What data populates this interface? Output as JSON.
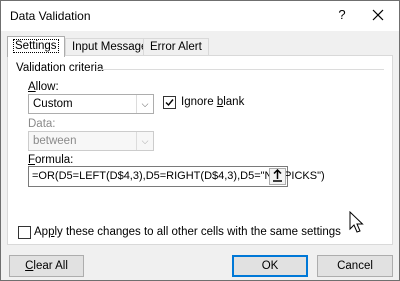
{
  "window": {
    "title": "Data Validation",
    "help_label": "?",
    "close_label": "✕"
  },
  "tabs": [
    {
      "label": "Settings",
      "active": true
    },
    {
      "label": "Input Message",
      "active": false
    },
    {
      "label": "Error Alert",
      "active": false
    }
  ],
  "criteria": {
    "group_label": "Validation criteria",
    "allow": {
      "label_mnemonic": "A",
      "label_rest": "llow:",
      "value": "Custom"
    },
    "ignore_blank": {
      "label_before": "Ignore ",
      "label_mnemonic": "b",
      "label_after": "lank",
      "checked": true
    },
    "data": {
      "label": "Data:",
      "value": "between",
      "disabled": true
    },
    "formula": {
      "label_mnemonic": "F",
      "label_rest": "ormula:",
      "value": "=OR(D5=LEFT(D$4,3),D5=RIGHT(D$4,3),D5=\"NO PICKS\")"
    }
  },
  "apply_all": {
    "label_before": "Ap",
    "label_mnemonic": "p",
    "label_after": "ly these changes to all other cells with the same settings",
    "checked": false
  },
  "buttons": {
    "clear_all_mnemonic": "C",
    "clear_all_rest": "lear All",
    "ok": "OK",
    "cancel": "Cancel"
  },
  "colors": {
    "accent": "#0078d7",
    "dialog_bg": "#f0f0f0"
  }
}
